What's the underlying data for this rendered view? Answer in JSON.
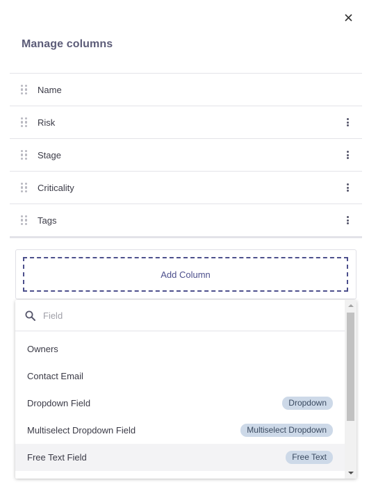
{
  "dialog": {
    "title": "Manage columns",
    "close_icon": "close-icon"
  },
  "columns": [
    {
      "label": "Name",
      "has_menu": false
    },
    {
      "label": "Risk",
      "has_menu": true
    },
    {
      "label": "Stage",
      "has_menu": true
    },
    {
      "label": "Criticality",
      "has_menu": true
    },
    {
      "label": "Tags",
      "has_menu": true
    }
  ],
  "add_column": {
    "label": "Add Column"
  },
  "field_picker": {
    "search_placeholder": "Field",
    "search_value": "",
    "options": [
      {
        "label": "Owners",
        "badge": ""
      },
      {
        "label": "Contact Email",
        "badge": ""
      },
      {
        "label": "Dropdown Field",
        "badge": "Dropdown"
      },
      {
        "label": "Multiselect Dropdown Field",
        "badge": "Multiselect Dropdown"
      },
      {
        "label": "Free Text Field",
        "badge": "Free Text",
        "highlighted": true
      }
    ]
  },
  "colors": {
    "title": "#5c5c78",
    "accent": "#4c4f8c",
    "badge_bg": "#cdd9e8",
    "highlight_bg": "#f3f3f5"
  }
}
